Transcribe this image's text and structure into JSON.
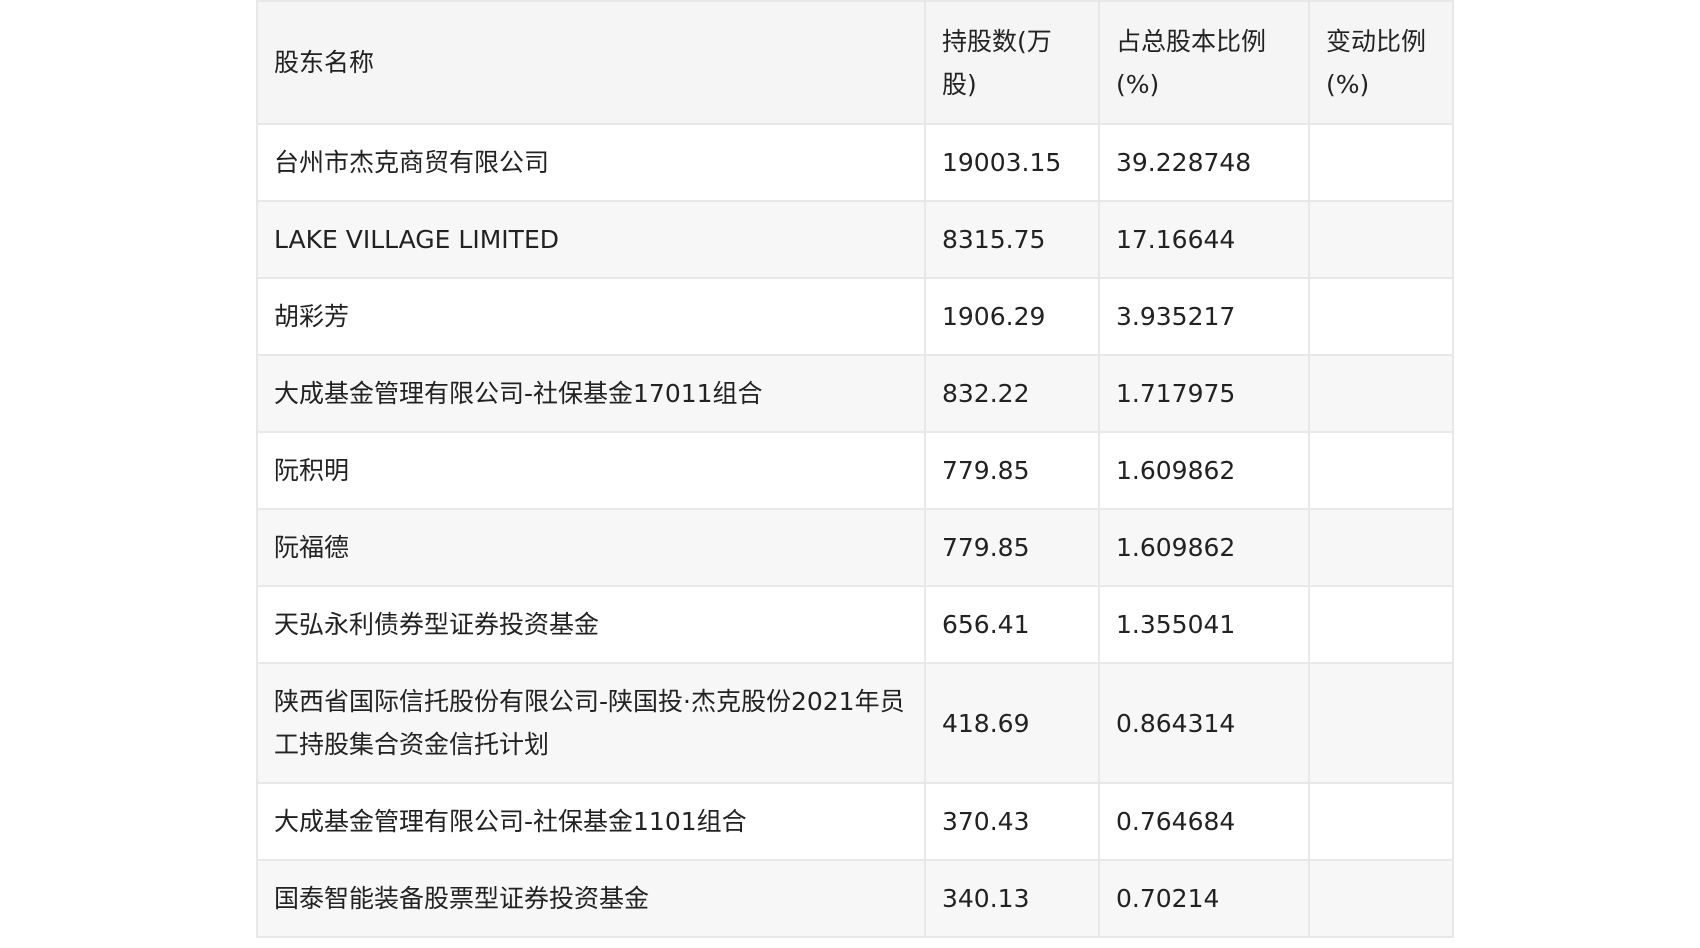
{
  "table": {
    "headers": [
      "股东名称",
      "持股数(万股)",
      "占总股本比例(%)",
      "变动比例(%)"
    ],
    "rows": [
      {
        "name": "台州市杰克商贸有限公司",
        "shares": "19003.15",
        "ratio": "39.228748",
        "change": ""
      },
      {
        "name": "LAKE VILLAGE LIMITED",
        "shares": "8315.75",
        "ratio": "17.16644",
        "change": ""
      },
      {
        "name": "胡彩芳",
        "shares": "1906.29",
        "ratio": "3.935217",
        "change": ""
      },
      {
        "name": "大成基金管理有限公司-社保基金17011组合",
        "shares": "832.22",
        "ratio": "1.717975",
        "change": ""
      },
      {
        "name": "阮积明",
        "shares": "779.85",
        "ratio": "1.609862",
        "change": ""
      },
      {
        "name": "阮福德",
        "shares": "779.85",
        "ratio": "1.609862",
        "change": ""
      },
      {
        "name": "天弘永利债券型证券投资基金",
        "shares": "656.41",
        "ratio": "1.355041",
        "change": ""
      },
      {
        "name": "陕西省国际信托股份有限公司-陕国投·杰克股份2021年员工持股集合资金信托计划",
        "shares": "418.69",
        "ratio": "0.864314",
        "change": ""
      },
      {
        "name": "大成基金管理有限公司-社保基金1101组合",
        "shares": "370.43",
        "ratio": "0.764684",
        "change": ""
      },
      {
        "name": "国泰智能装备股票型证券投资基金",
        "shares": "340.13",
        "ratio": "0.70214",
        "change": ""
      }
    ]
  }
}
